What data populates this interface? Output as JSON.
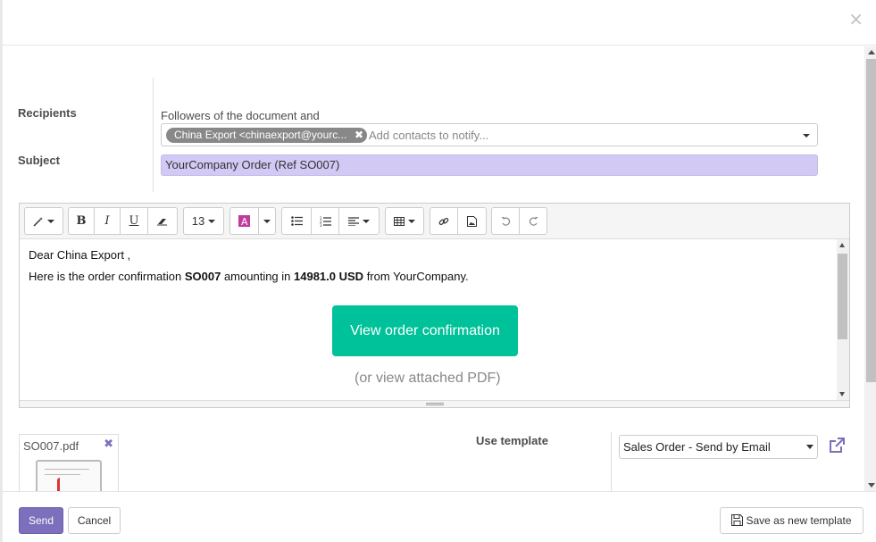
{
  "dialog": {
    "close_label": "×"
  },
  "form": {
    "recipients_label": "Recipients",
    "followers_text": "Followers of the document and",
    "recipient_tag": "China Export <chinaexport@yourc...",
    "recipient_tag_remove": "✖",
    "add_contacts_placeholder": "Add contacts to notify...",
    "subject_label": "Subject",
    "subject_value": "YourCompany Order (Ref SO007)"
  },
  "toolbar": {
    "font_size": "13",
    "bold": "B",
    "italic": "I",
    "underline": "U"
  },
  "body": {
    "greeting": "Dear China Export ,",
    "line_prefix": "Here is the order confirmation ",
    "order_ref": "SO007",
    "line_mid": " amounting in ",
    "amount": "14981.0 USD",
    "line_suffix": " from YourCompany.",
    "cta_label": "View order confirmation",
    "pdf_note": "(or view attached PDF)"
  },
  "attachment": {
    "filename": "SO007.pdf",
    "remove": "✖"
  },
  "template": {
    "label": "Use template",
    "selected": "Sales Order - Send by Email"
  },
  "footer": {
    "send": "Send",
    "cancel": "Cancel",
    "save_template": "Save as new template"
  },
  "colors": {
    "primary": "#7c6fbc",
    "cta": "#00c29a",
    "subject_bg": "#d2c9f5",
    "tag_bg": "#888888"
  }
}
